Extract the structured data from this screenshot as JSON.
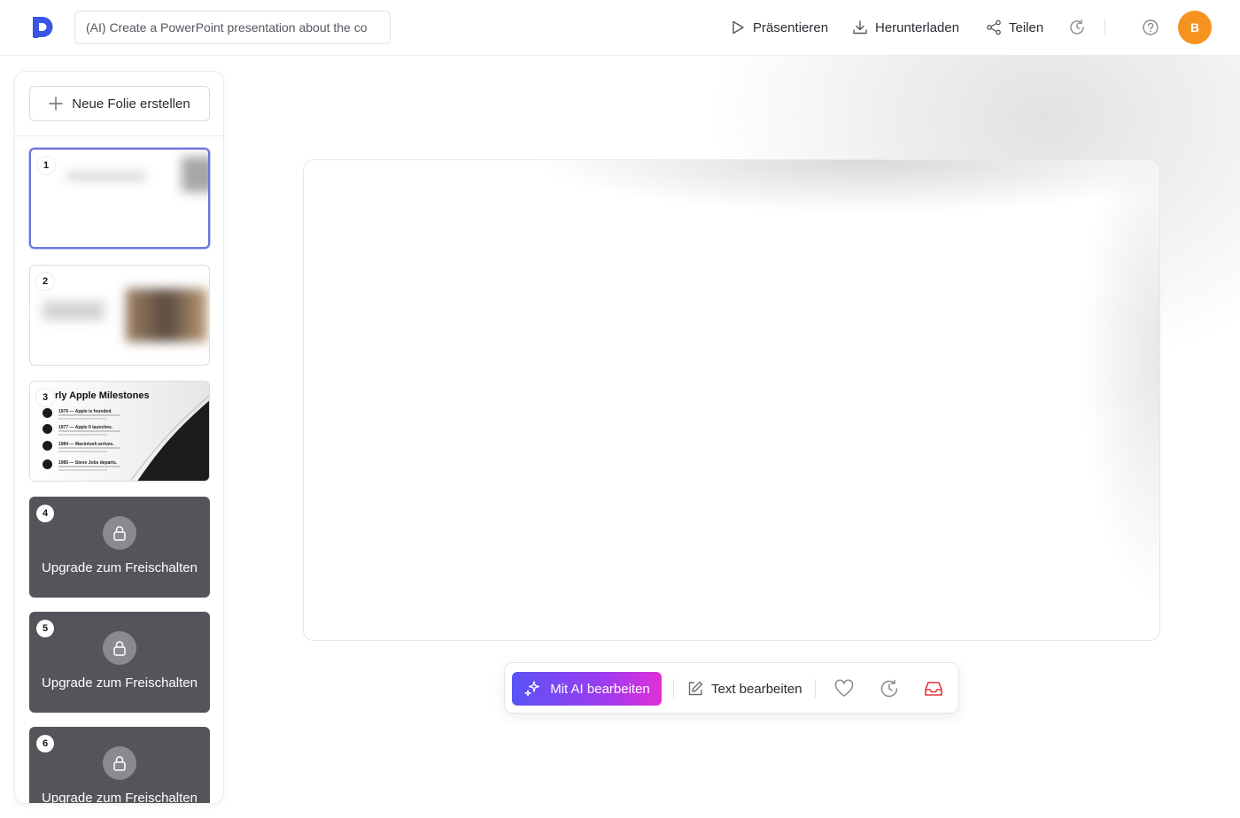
{
  "header": {
    "logo": "d-logo",
    "prompt_text": "(AI) Create a PowerPoint presentation about the co",
    "present_label": "Präsentieren",
    "download_label": "Herunterladen",
    "share_label": "Teilen",
    "avatar_initial": "B",
    "avatar_color": "#f5931e",
    "accent_color": "#3b55e6"
  },
  "sidebar": {
    "new_slide_label": "Neue Folie erstellen",
    "slides": [
      {
        "number": "1",
        "state": "preview"
      },
      {
        "number": "2",
        "state": "preview"
      },
      {
        "number": "3",
        "state": "preview",
        "title": "rly Apple Milestones",
        "items": [
          {
            "heading": "1976 — Apple is founded."
          },
          {
            "heading": "1977 — Apple II launches."
          },
          {
            "heading": "1984 — Macintosh arrives."
          },
          {
            "heading": "1985 — Steve Jobs departs."
          }
        ]
      },
      {
        "number": "4",
        "state": "locked",
        "label": "Upgrade zum Freischalten"
      },
      {
        "number": "5",
        "state": "locked",
        "label": "Upgrade zum Freischalten"
      },
      {
        "number": "6",
        "state": "locked",
        "label": "Upgrade zum Freischalten"
      }
    ]
  },
  "toolbar": {
    "ai_edit_label": "Mit AI bearbeiten",
    "text_edit_label": "Text bearbeiten",
    "icons": [
      "heart-icon",
      "history-icon",
      "inbox-icon"
    ]
  }
}
